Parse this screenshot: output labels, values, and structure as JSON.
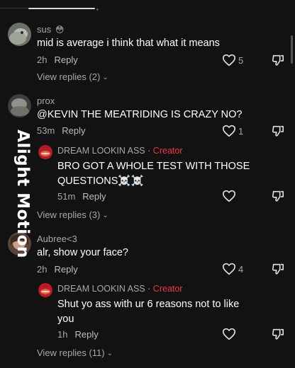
{
  "watermark": "Alight Motion",
  "comments": [
    {
      "author": "sus",
      "author_emoji": "😳",
      "text": "mid is average i think that what it means",
      "time": "2h",
      "reply_label": "Reply",
      "likes": "5",
      "view_replies": "View replies (2)"
    },
    {
      "author": "prox",
      "text": "@KEVIN THE MEATRIDING IS CRAZY NO?",
      "time": "53m",
      "reply_label": "Reply",
      "likes": "1",
      "reply": {
        "author": "DREAM LOOKIN ASS",
        "separator": "·",
        "creator_label": "Creator",
        "text_line1": "BRO GOT A WHOLE TEST WITH THOSE",
        "text_line2": "QUESTIONS☠️☠️",
        "time": "51m",
        "reply_label": "Reply"
      },
      "view_replies": "View replies (3)"
    },
    {
      "author": "Aubree<3",
      "text": "alr, show your face?",
      "time": "2h",
      "reply_label": "Reply",
      "likes": "4",
      "reply": {
        "author": "DREAM LOOKIN ASS",
        "separator": "·",
        "creator_label": "Creator",
        "text_line1": "Shut yo ass with ur 6 reasons not to like",
        "text_line2": "you",
        "time": "1h",
        "reply_label": "Reply"
      },
      "view_replies": "View replies (11)"
    }
  ],
  "icons": {
    "like": "heart-outline-icon",
    "dislike": "thumbs-down-icon",
    "expand": "chevron-down-icon"
  },
  "colors": {
    "background": "#121212",
    "creator": "#f0344a",
    "secondary_text": "#a8a8a8"
  }
}
